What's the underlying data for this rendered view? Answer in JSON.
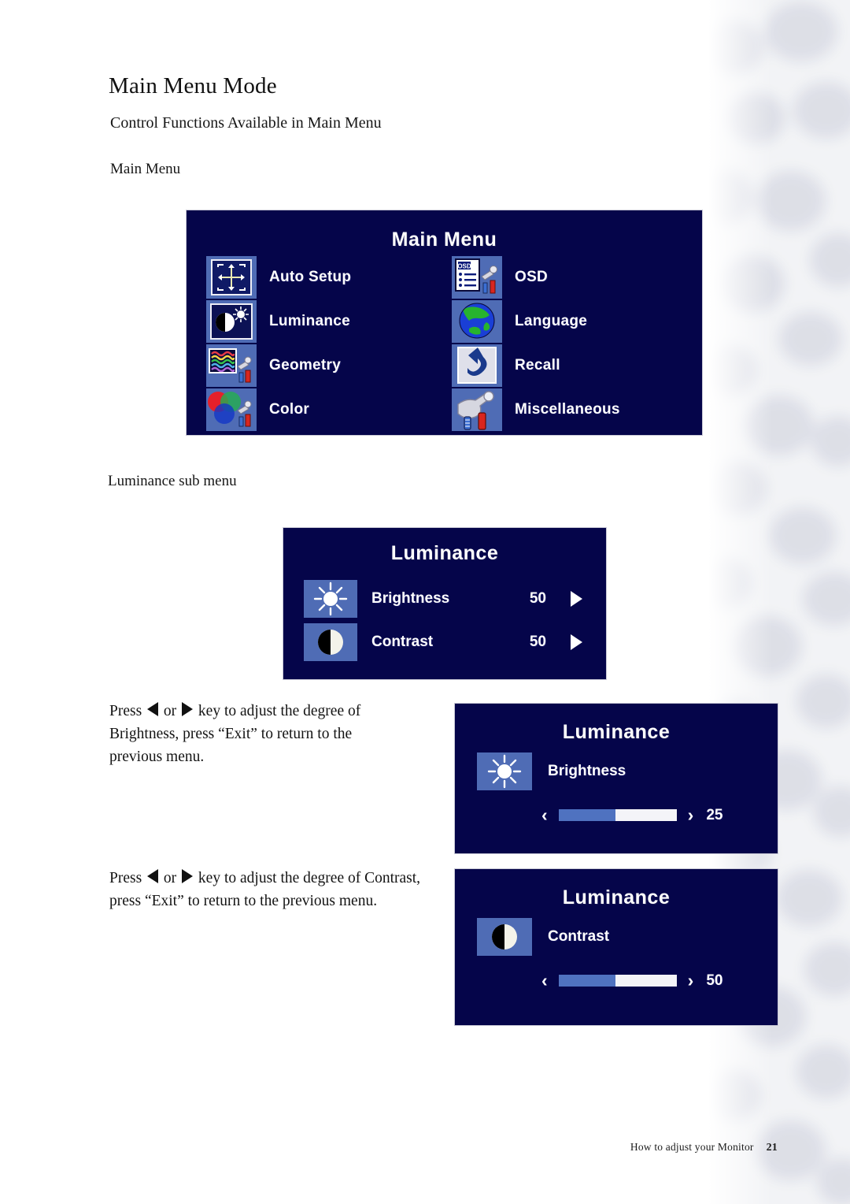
{
  "page": {
    "heading": "Main Menu Mode",
    "subheading": "Control Functions Available in Main Menu",
    "section_main_menu": "Main Menu",
    "section_luminance": "Luminance sub menu"
  },
  "osd_main_menu": {
    "title": "Main Menu",
    "left_column": [
      {
        "label": "Auto Setup",
        "icon": "auto-setup-icon"
      },
      {
        "label": "Luminance",
        "icon": "luminance-icon"
      },
      {
        "label": "Geometry",
        "icon": "geometry-icon"
      },
      {
        "label": "Color",
        "icon": "color-icon"
      }
    ],
    "right_column": [
      {
        "label": "OSD",
        "icon": "osd-icon"
      },
      {
        "label": "Language",
        "icon": "globe-icon"
      },
      {
        "label": "Recall",
        "icon": "recall-arrow-icon"
      },
      {
        "label": "Miscellaneous",
        "icon": "tools-icon"
      }
    ]
  },
  "osd_luminance_list": {
    "title": "Luminance",
    "rows": [
      {
        "label": "Brightness",
        "value": "50",
        "icon": "sun-icon",
        "arrow": "right-arrow-icon"
      },
      {
        "label": "Contrast",
        "value": "50",
        "icon": "contrast-circle-icon",
        "arrow": "right-arrow-icon"
      }
    ]
  },
  "osd_brightness_adjust": {
    "title": "Luminance",
    "item_label": "Brightness",
    "icon": "sun-icon",
    "value": "25",
    "fill_percent": 48,
    "left_chevron": "‹",
    "right_chevron": "›"
  },
  "osd_contrast_adjust": {
    "title": "Luminance",
    "item_label": "Contrast",
    "icon": "contrast-circle-icon",
    "value": "50",
    "fill_percent": 48,
    "left_chevron": "‹",
    "right_chevron": "›"
  },
  "body_text": {
    "brightness_pre": "Press ",
    "brightness_mid": " or ",
    "brightness_post": " key to adjust the degree of Brightness, press “Exit” to return to the previous menu.",
    "contrast_pre": "Press ",
    "contrast_mid": " or ",
    "contrast_post": " key to adjust the degree of Contrast, press “Exit” to return to the previous menu."
  },
  "footer": {
    "text": "How to adjust your Monitor",
    "page_number": "21"
  },
  "colors": {
    "osd_background": "#05054a",
    "osd_tile": "#4f6cb5",
    "slider_fill": "#4f72c0",
    "slider_track": "#f4f4f8",
    "text_white": "#ffffff"
  }
}
